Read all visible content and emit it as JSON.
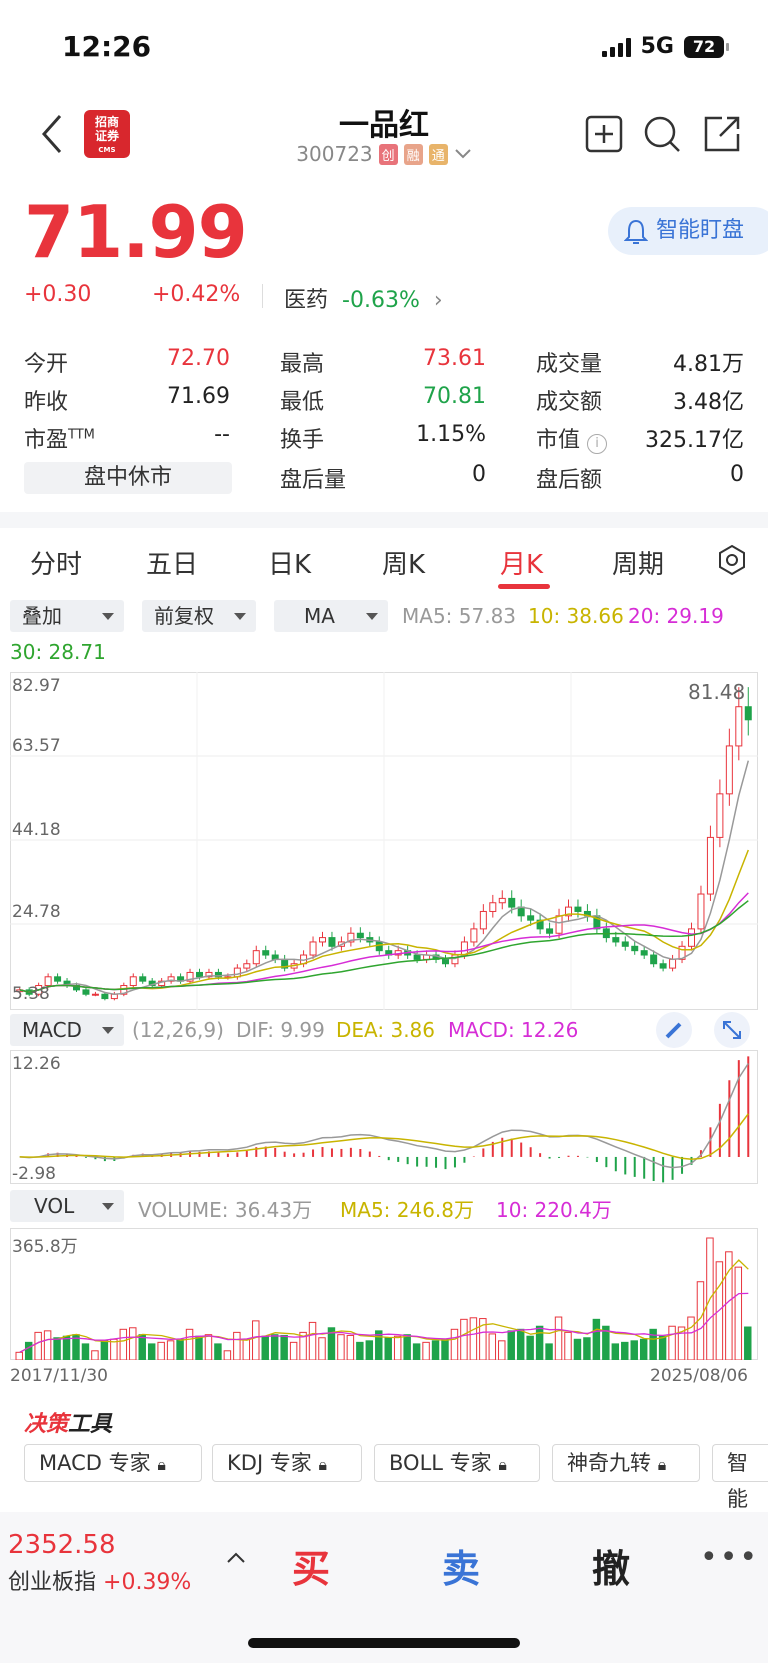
{
  "status": {
    "time": "12:26",
    "network": "5G",
    "battery": "72"
  },
  "header": {
    "logo_line1": "招商",
    "logo_line2": "证券",
    "logo_sub": "CMS",
    "title": "一品红",
    "code": "300723",
    "tags": [
      "创",
      "融",
      "通"
    ]
  },
  "quote": {
    "price": "71.99",
    "change": "+0.30",
    "change_pct": "+0.42%",
    "sector": "医药",
    "sector_pct": "-0.63%",
    "monitor_label": "智能盯盘"
  },
  "stats": {
    "open_label": "今开",
    "open": "72.70",
    "prev_label": "昨收",
    "prev": "71.69",
    "pe_label": "市盈",
    "pe_sup": "TTM",
    "pe": "--",
    "status": "盘中休市",
    "high_label": "最高",
    "high": "73.61",
    "low_label": "最低",
    "low": "70.81",
    "turn_label": "换手",
    "turn": "1.15%",
    "ahvol_label": "盘后量",
    "ahvol": "0",
    "vol_label": "成交量",
    "vol": "4.81万",
    "amt_label": "成交额",
    "amt": "3.48亿",
    "cap_label": "市值",
    "cap": "325.17亿",
    "ahamt_label": "盘后额",
    "ahamt": "0"
  },
  "tabs": [
    "分时",
    "五日",
    "日K",
    "周K",
    "月K",
    "周期"
  ],
  "active_tab": "月K",
  "controls": {
    "overlay": "叠加",
    "adjust": "前复权",
    "indicator": "MA"
  },
  "ma": {
    "ma5": "MA5: 57.83",
    "ma10": "10: 38.66",
    "ma20": "20: 29.19",
    "ma30": "30: 28.71"
  },
  "ma_colors": {
    "ma5": "#999999",
    "ma10": "#c8b400",
    "ma20": "#d62dd6",
    "ma30": "#2fa52f"
  },
  "price_axis": [
    "82.97",
    "63.57",
    "44.18",
    "24.78",
    "5.38"
  ],
  "max_label": "81.48",
  "macd": {
    "name": "MACD",
    "params": "(12,26,9)",
    "dif": "DIF: 9.99",
    "dea": "DEA: 3.86",
    "macd": "MACD: 12.26",
    "top": "12.26",
    "bottom": "-2.98"
  },
  "vol": {
    "name": "VOL",
    "volume": "VOLUME: 36.43万",
    "ma5": "MA5: 246.8万",
    "ma10": "10: 220.4万",
    "top": "365.8万"
  },
  "dates": {
    "start": "2017/11/30",
    "end": "2025/08/06"
  },
  "tools": {
    "title_a": "决策",
    "title_b": "工具",
    "chips": [
      "MACD 专家",
      "KDJ 专家",
      "BOLL 专家",
      "神奇九转",
      "智能"
    ]
  },
  "bottom": {
    "index_value": "2352.58",
    "index_name": "创业板指",
    "index_pct": "+0.39%",
    "buy": "买",
    "sell": "卖",
    "cancel": "撤"
  },
  "chart_data": {
    "type": "candlestick",
    "period": "monthly",
    "ylim": [
      5.38,
      82.97
    ],
    "close": [
      10,
      9,
      11,
      13,
      12,
      11,
      10,
      9,
      9,
      8,
      9,
      11,
      13,
      12,
      11,
      12,
      13,
      12,
      14,
      13,
      14,
      13,
      13,
      15,
      16,
      19,
      18,
      17,
      15,
      16,
      18,
      21,
      22,
      20,
      21,
      23,
      22,
      21,
      19,
      18,
      19,
      18,
      17,
      18,
      17,
      16,
      18,
      21,
      24,
      28,
      30,
      31,
      29,
      27,
      26,
      24,
      23,
      27,
      29,
      28,
      27,
      24,
      22,
      21,
      20,
      19,
      18,
      16,
      15,
      17,
      20,
      24,
      32,
      45,
      55,
      66,
      75,
      72
    ]
  }
}
